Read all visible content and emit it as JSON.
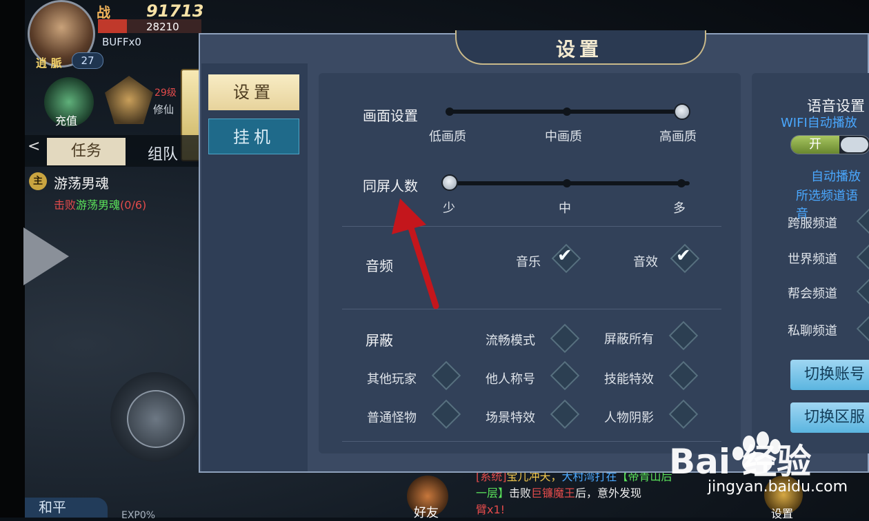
{
  "hud": {
    "zhan_label": "战",
    "power": "91713",
    "hp": "28210",
    "buff": "BUFFx0",
    "level": "27",
    "name_tag": "逍 脈",
    "recharge_label": "充值",
    "rank_level": "29级",
    "rank_sub": "修仙",
    "tab_task": "任务",
    "tab_team": "组队",
    "back": "<",
    "quest_badge": "主",
    "quest_title": "游荡男魂",
    "quest_desc_prefix": "击败",
    "quest_desc_target": "游荡男魂",
    "quest_desc_progress": "(0/6)",
    "peace_label": "和平",
    "exp_label": "EXP0%",
    "friend_label": "好友",
    "settings_label": "设置"
  },
  "chat": {
    "line1_a": "[系统]",
    "line1_b": "宝儿冲天，",
    "line1_c": "大村湾打在",
    "line1_d": "【帝青山后",
    "line2_a": "一层】",
    "line2_b": "击败",
    "line2_c": "巨镰魔王",
    "line2_d": "后，意外发现",
    "line3": "臂x1!"
  },
  "panel": {
    "title": "设置",
    "tabs": [
      {
        "label": "设置",
        "active": true
      },
      {
        "label": "挂机",
        "active": false
      }
    ],
    "graphics": {
      "label": "画面设置",
      "options": [
        "低画质",
        "中画质",
        "高画质"
      ],
      "selected": "高画质"
    },
    "players_on_screen": {
      "label": "同屏人数",
      "options": [
        "少",
        "中",
        "多"
      ],
      "selected": "少"
    },
    "audio": {
      "label": "音频",
      "music_label": "音乐",
      "music_checked": true,
      "sfx_label": "音效",
      "sfx_checked": true
    },
    "block": {
      "label": "屏蔽",
      "items": [
        {
          "label": "流畅模式",
          "checked": false
        },
        {
          "label": "屏蔽所有",
          "checked": false
        },
        {
          "label": "其他玩家",
          "checked": false
        },
        {
          "label": "他人称号",
          "checked": false
        },
        {
          "label": "技能特效",
          "checked": false
        },
        {
          "label": "普通怪物",
          "checked": false
        },
        {
          "label": "场景特效",
          "checked": false
        },
        {
          "label": "人物阴影",
          "checked": false
        }
      ]
    },
    "voice": {
      "title": "语音设置",
      "wifi_autoplay": "WIFI自动播放",
      "toggle_label": "开",
      "auto_play": "自动播放",
      "selected_channel": "所选频道语音",
      "channels": [
        "跨服频道",
        "世界频道",
        "帮会频道",
        "私聊频道"
      ]
    },
    "buttons": {
      "switch_account": "切换账号",
      "switch_server": "切换区服"
    }
  },
  "watermark": {
    "brand": "Bai  经验",
    "url": "jingyan.baidu.com"
  },
  "colors": {
    "panel_bg": "#3b4a63",
    "active_tab": "#f8ecc4",
    "inactive_tab": "#1f6a8a",
    "accent_blue": "#4aa8ff",
    "arrow_red": "#c4161c"
  }
}
